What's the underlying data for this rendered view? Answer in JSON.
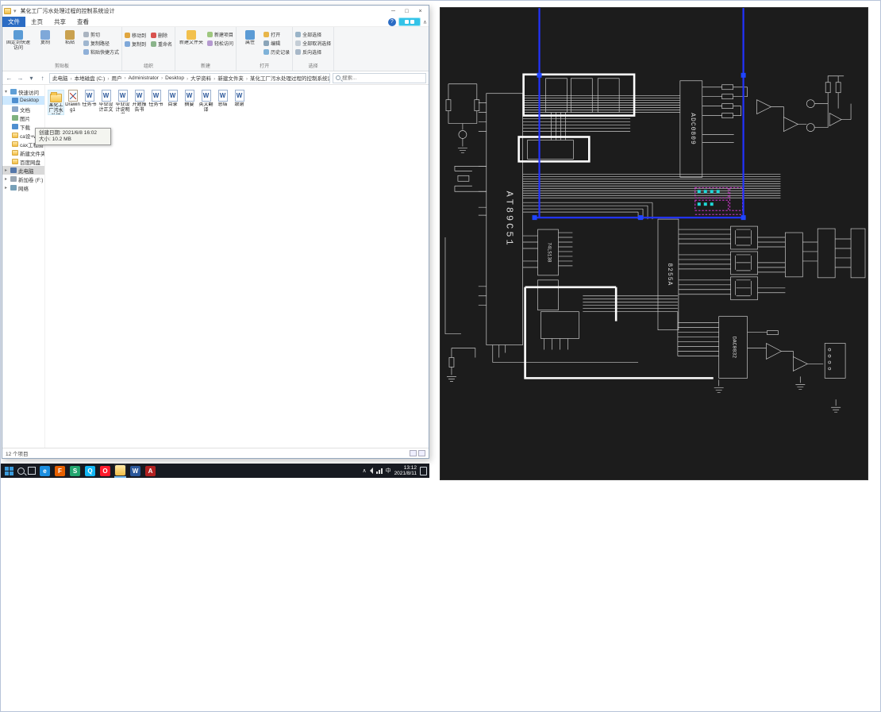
{
  "explorer": {
    "title": "某化工厂污水处理过程的控制系统设计",
    "window_controls": {
      "minimize": "─",
      "maximize": "□",
      "close": "×"
    },
    "quick_access_arrow": "▾",
    "tabs": {
      "file": "文件",
      "home": "主页",
      "share": "共享",
      "view": "查看"
    },
    "help_glyph": "?",
    "collapse_glyph": "∧",
    "nav": {
      "back": "←",
      "forward": "→",
      "dropdown": "▾",
      "up": "↑",
      "refresh": "↻"
    },
    "ribbon": {
      "pin": "固定到快速访问",
      "copy": "复制",
      "paste": "粘贴",
      "cut": "剪切",
      "copy_path": "复制路径",
      "paste_shortcut": "粘贴快捷方式",
      "move_to": "移动到",
      "copy_to": "复制到",
      "delete": "删除",
      "rename": "重命名",
      "new_folder": "新建文件夹",
      "new_item": "新建项目",
      "easy_access": "轻松访问",
      "properties": "属性",
      "open": "打开",
      "edit": "编辑",
      "history": "历史记录",
      "select_all": "全部选择",
      "select_none": "全部取消选择",
      "invert_selection": "反向选择",
      "groups": {
        "clipboard": "剪贴板",
        "organize": "组织",
        "new": "新建",
        "open": "打开",
        "select": "选择"
      }
    },
    "address": {
      "segments": [
        "此电脑",
        "本地磁盘 (C:)",
        "用户",
        "Administrator",
        "Desktop",
        "大学资料",
        "新建文件夹",
        "某化工厂污水处理过程的控制系统设计"
      ]
    },
    "search_placeholder": "搜索...",
    "sidebar": {
      "items": [
        {
          "label": "快速访问"
        },
        {
          "label": "Desktop"
        },
        {
          "label": "文档"
        },
        {
          "label": "图片"
        },
        {
          "label": "下载"
        },
        {
          "label": "ca设+web图"
        },
        {
          "label": "cax工程图"
        },
        {
          "label": "新建文件夹"
        },
        {
          "label": "百度网盘"
        },
        {
          "label": "此电脑"
        },
        {
          "label": "新加卷 (F:)"
        },
        {
          "label": "网络"
        }
      ]
    },
    "doc_glyph": "W",
    "files": [
      {
        "label": "某化工厂污水处理"
      },
      {
        "label": "Drawing1"
      },
      {
        "label": "任务书"
      },
      {
        "label": "毕业设计正文"
      },
      {
        "label": "毕业设计说明书"
      },
      {
        "label": "开题报告书"
      },
      {
        "label": "任务书"
      },
      {
        "label": "目录"
      },
      {
        "label": "摘要"
      },
      {
        "label": "英文翻译"
      },
      {
        "label": "总结"
      },
      {
        "label": "致谢"
      }
    ],
    "tooltip": {
      "line1": "创建日期: 2021/6/8 16:02",
      "line2": "大小: 10.2 MB"
    },
    "status": {
      "items_count": "12 个项目"
    }
  },
  "taskbar": {
    "tray_arrow": "∧",
    "ime": "中",
    "time": "13:12",
    "date": "2021/8/11",
    "icons": [
      {
        "name": "browser-edge",
        "glyph": "e"
      },
      {
        "name": "browser-firefox",
        "glyph": "F"
      },
      {
        "name": "app-green",
        "glyph": "S"
      },
      {
        "name": "app-qq",
        "glyph": "Q"
      },
      {
        "name": "browser-opera",
        "glyph": "O"
      },
      {
        "name": "file-explorer",
        "glyph": ""
      },
      {
        "name": "word",
        "glyph": "W"
      },
      {
        "name": "autocad",
        "glyph": "A"
      }
    ]
  },
  "cad": {
    "labels": {
      "mcu": "AT89C51",
      "adc": "ADC0809",
      "ppi": "8255A",
      "decoder": "74LS138",
      "dac": "DAC0832"
    },
    "colors": {
      "selection_blue": "#2233ff",
      "highlight_magenta": "#e83ae8",
      "background": "#1c1c1c"
    }
  }
}
